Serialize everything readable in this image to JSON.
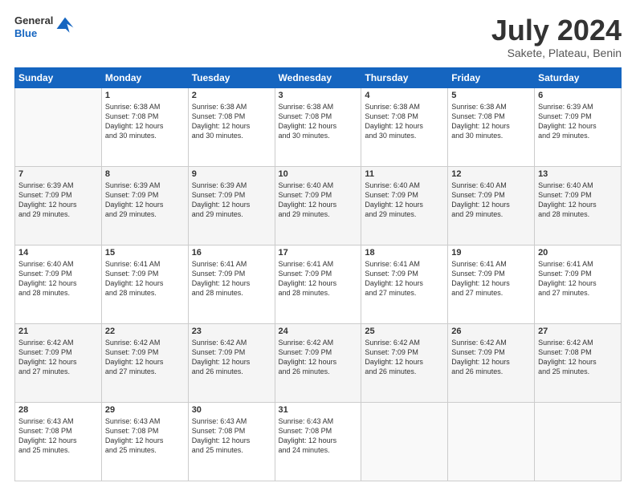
{
  "header": {
    "logo_general": "General",
    "logo_blue": "Blue",
    "title": "July 2024",
    "location": "Sakete, Plateau, Benin"
  },
  "days_of_week": [
    "Sunday",
    "Monday",
    "Tuesday",
    "Wednesday",
    "Thursday",
    "Friday",
    "Saturday"
  ],
  "weeks": [
    [
      {
        "day": "",
        "info": ""
      },
      {
        "day": "1",
        "info": "Sunrise: 6:38 AM\nSunset: 7:08 PM\nDaylight: 12 hours\nand 30 minutes."
      },
      {
        "day": "2",
        "info": "Sunrise: 6:38 AM\nSunset: 7:08 PM\nDaylight: 12 hours\nand 30 minutes."
      },
      {
        "day": "3",
        "info": "Sunrise: 6:38 AM\nSunset: 7:08 PM\nDaylight: 12 hours\nand 30 minutes."
      },
      {
        "day": "4",
        "info": "Sunrise: 6:38 AM\nSunset: 7:08 PM\nDaylight: 12 hours\nand 30 minutes."
      },
      {
        "day": "5",
        "info": "Sunrise: 6:38 AM\nSunset: 7:08 PM\nDaylight: 12 hours\nand 30 minutes."
      },
      {
        "day": "6",
        "info": "Sunrise: 6:39 AM\nSunset: 7:09 PM\nDaylight: 12 hours\nand 29 minutes."
      }
    ],
    [
      {
        "day": "7",
        "info": "Sunrise: 6:39 AM\nSunset: 7:09 PM\nDaylight: 12 hours\nand 29 minutes."
      },
      {
        "day": "8",
        "info": "Sunrise: 6:39 AM\nSunset: 7:09 PM\nDaylight: 12 hours\nand 29 minutes."
      },
      {
        "day": "9",
        "info": "Sunrise: 6:39 AM\nSunset: 7:09 PM\nDaylight: 12 hours\nand 29 minutes."
      },
      {
        "day": "10",
        "info": "Sunrise: 6:40 AM\nSunset: 7:09 PM\nDaylight: 12 hours\nand 29 minutes."
      },
      {
        "day": "11",
        "info": "Sunrise: 6:40 AM\nSunset: 7:09 PM\nDaylight: 12 hours\nand 29 minutes."
      },
      {
        "day": "12",
        "info": "Sunrise: 6:40 AM\nSunset: 7:09 PM\nDaylight: 12 hours\nand 29 minutes."
      },
      {
        "day": "13",
        "info": "Sunrise: 6:40 AM\nSunset: 7:09 PM\nDaylight: 12 hours\nand 28 minutes."
      }
    ],
    [
      {
        "day": "14",
        "info": "Sunrise: 6:40 AM\nSunset: 7:09 PM\nDaylight: 12 hours\nand 28 minutes."
      },
      {
        "day": "15",
        "info": "Sunrise: 6:41 AM\nSunset: 7:09 PM\nDaylight: 12 hours\nand 28 minutes."
      },
      {
        "day": "16",
        "info": "Sunrise: 6:41 AM\nSunset: 7:09 PM\nDaylight: 12 hours\nand 28 minutes."
      },
      {
        "day": "17",
        "info": "Sunrise: 6:41 AM\nSunset: 7:09 PM\nDaylight: 12 hours\nand 28 minutes."
      },
      {
        "day": "18",
        "info": "Sunrise: 6:41 AM\nSunset: 7:09 PM\nDaylight: 12 hours\nand 27 minutes."
      },
      {
        "day": "19",
        "info": "Sunrise: 6:41 AM\nSunset: 7:09 PM\nDaylight: 12 hours\nand 27 minutes."
      },
      {
        "day": "20",
        "info": "Sunrise: 6:41 AM\nSunset: 7:09 PM\nDaylight: 12 hours\nand 27 minutes."
      }
    ],
    [
      {
        "day": "21",
        "info": "Sunrise: 6:42 AM\nSunset: 7:09 PM\nDaylight: 12 hours\nand 27 minutes."
      },
      {
        "day": "22",
        "info": "Sunrise: 6:42 AM\nSunset: 7:09 PM\nDaylight: 12 hours\nand 27 minutes."
      },
      {
        "day": "23",
        "info": "Sunrise: 6:42 AM\nSunset: 7:09 PM\nDaylight: 12 hours\nand 26 minutes."
      },
      {
        "day": "24",
        "info": "Sunrise: 6:42 AM\nSunset: 7:09 PM\nDaylight: 12 hours\nand 26 minutes."
      },
      {
        "day": "25",
        "info": "Sunrise: 6:42 AM\nSunset: 7:09 PM\nDaylight: 12 hours\nand 26 minutes."
      },
      {
        "day": "26",
        "info": "Sunrise: 6:42 AM\nSunset: 7:09 PM\nDaylight: 12 hours\nand 26 minutes."
      },
      {
        "day": "27",
        "info": "Sunrise: 6:42 AM\nSunset: 7:08 PM\nDaylight: 12 hours\nand 25 minutes."
      }
    ],
    [
      {
        "day": "28",
        "info": "Sunrise: 6:43 AM\nSunset: 7:08 PM\nDaylight: 12 hours\nand 25 minutes."
      },
      {
        "day": "29",
        "info": "Sunrise: 6:43 AM\nSunset: 7:08 PM\nDaylight: 12 hours\nand 25 minutes."
      },
      {
        "day": "30",
        "info": "Sunrise: 6:43 AM\nSunset: 7:08 PM\nDaylight: 12 hours\nand 25 minutes."
      },
      {
        "day": "31",
        "info": "Sunrise: 6:43 AM\nSunset: 7:08 PM\nDaylight: 12 hours\nand 24 minutes."
      },
      {
        "day": "",
        "info": ""
      },
      {
        "day": "",
        "info": ""
      },
      {
        "day": "",
        "info": ""
      }
    ]
  ]
}
